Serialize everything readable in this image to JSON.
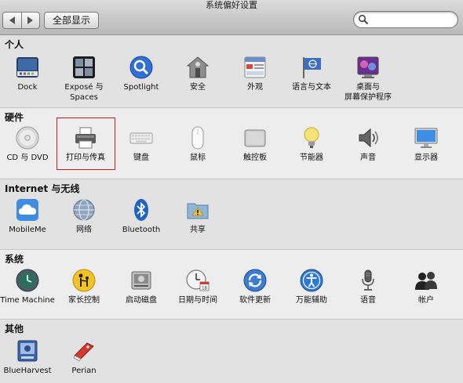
{
  "window": {
    "title": "系统偏好设置"
  },
  "toolbar": {
    "back_label": "◀",
    "forward_label": "▶",
    "show_all_label": "全部显示",
    "search": {
      "value": "",
      "placeholder": ""
    }
  },
  "sections": [
    {
      "title": "个人",
      "items": [
        {
          "label": "Dock",
          "icon": "dock-icon"
        },
        {
          "label": "Exposé 与\nSpaces",
          "icon": "expose-spaces-icon"
        },
        {
          "label": "Spotlight",
          "icon": "spotlight-icon"
        },
        {
          "label": "安全",
          "icon": "security-house-icon"
        },
        {
          "label": "外观",
          "icon": "appearance-icon"
        },
        {
          "label": "语言与文本",
          "icon": "language-flag-icon"
        },
        {
          "label": "桌面与\n屏幕保护程序",
          "icon": "desktop-screensaver-icon"
        }
      ]
    },
    {
      "title": "硬件",
      "items": [
        {
          "label": "CD 与 DVD",
          "icon": "cd-dvd-icon"
        },
        {
          "label": "打印与传真",
          "icon": "printer-icon"
        },
        {
          "label": "键盘",
          "icon": "keyboard-icon"
        },
        {
          "label": "鼠标",
          "icon": "mouse-icon"
        },
        {
          "label": "触控板",
          "icon": "trackpad-icon"
        },
        {
          "label": "节能器",
          "icon": "lightbulb-icon"
        },
        {
          "label": "声音",
          "icon": "speaker-icon"
        },
        {
          "label": "显示器",
          "icon": "display-icon"
        }
      ]
    },
    {
      "title": "Internet 与无线",
      "items": [
        {
          "label": "MobileMe",
          "icon": "mobileme-cloud-icon"
        },
        {
          "label": "网络",
          "icon": "network-globe-icon"
        },
        {
          "label": "Bluetooth",
          "icon": "bluetooth-icon"
        },
        {
          "label": "共享",
          "icon": "sharing-folder-icon"
        }
      ]
    },
    {
      "title": "系统",
      "items": [
        {
          "label": "Time Machine",
          "icon": "time-machine-icon"
        },
        {
          "label": "家长控制",
          "icon": "parental-controls-icon"
        },
        {
          "label": "启动磁盘",
          "icon": "startup-disk-icon"
        },
        {
          "label": "日期与时间",
          "icon": "date-time-icon"
        },
        {
          "label": "软件更新",
          "icon": "software-update-icon"
        },
        {
          "label": "万能辅助",
          "icon": "universal-access-icon"
        },
        {
          "label": "语音",
          "icon": "speech-microphone-icon"
        },
        {
          "label": "帐户",
          "icon": "accounts-icon"
        }
      ]
    },
    {
      "title": "其他",
      "items": [
        {
          "label": "BlueHarvest",
          "icon": "blueharvest-icon"
        },
        {
          "label": "Perian",
          "icon": "perian-icon"
        }
      ]
    }
  ],
  "colors": {
    "highlight_border": "#c02020",
    "section_alt_bg": "#e2e2e2",
    "window_bg": "#ececec"
  }
}
